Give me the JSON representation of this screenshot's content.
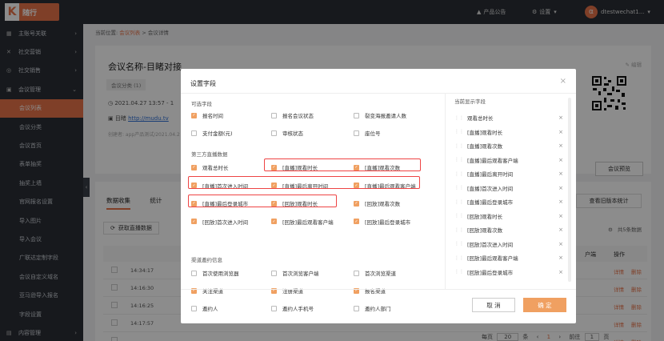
{
  "topbar": {
    "logo_letter": "K",
    "logo_text": "随行",
    "announce": "产品公告",
    "settings": "设置",
    "user": "dtestwechat1..."
  },
  "sidebar": {
    "items": [
      {
        "label": "主账号关联",
        "icon": "grid-icon",
        "arrow": "›"
      },
      {
        "label": "社交营销",
        "icon": "share-icon",
        "arrow": "›"
      },
      {
        "label": "社交销售",
        "icon": "target-icon",
        "arrow": "›"
      },
      {
        "label": "会议管理",
        "icon": "monitor-icon",
        "arrow": "⌄"
      },
      {
        "label": "会议列表",
        "sub": true,
        "active": true
      },
      {
        "label": "会议分类",
        "sub": true
      },
      {
        "label": "会议首页",
        "sub": true
      },
      {
        "label": "表单抽奖",
        "sub": true
      },
      {
        "label": "抽奖上墙",
        "sub": true
      },
      {
        "label": "官网报名设置",
        "sub": true
      },
      {
        "label": "导入图片",
        "sub": true
      },
      {
        "label": "导入会议",
        "sub": true
      },
      {
        "label": "广联达定制字段",
        "sub": true
      },
      {
        "label": "会议自定义域名",
        "sub": true
      },
      {
        "label": "亚马逊导入报名",
        "sub": true
      },
      {
        "label": "字段设置",
        "sub": true
      },
      {
        "label": "内容管理",
        "icon": "doc-icon",
        "arrow": "›"
      }
    ]
  },
  "main": {
    "crumb_prefix": "当前位置:",
    "crumb_link": "会议列表",
    "crumb_sep": ">",
    "crumb_current": "会议详情",
    "conf_title": "会议名称-目睹对接",
    "conf_tag": "会议分类 (1)",
    "edit": "编辑",
    "conf_date": "2021.04.27 13:57 - 1",
    "conf_url_label": "目睹",
    "conf_url": "http://mudu.tv",
    "conf_meta": "创建者:  app产品测试/2021.04.2",
    "preview": "会议预览",
    "tabs": [
      "数据收集",
      "统计"
    ],
    "old_stats": "查看旧版本统计",
    "fetch_live": "获取直播数据",
    "total": "共5条数据",
    "col_client": "户端",
    "col_action": "操作",
    "rows": [
      {
        "time": "14:34:17",
        "a1": "详情",
        "a2": "删除"
      },
      {
        "time": "14:16:30",
        "a1": "详情",
        "a2": "删除"
      },
      {
        "time": "14:16:25",
        "a1": "详情",
        "a2": "删除"
      },
      {
        "time": "14:17:57",
        "a1": "详情",
        "a2": "删除"
      },
      {
        "time": "",
        "a1": "详情",
        "a2": "删除"
      }
    ],
    "pager": {
      "per_page": "每页",
      "size": "20",
      "unit": "条",
      "prev": "‹",
      "page": "1",
      "next": "›",
      "goto": "前往",
      "page2": "1",
      "page_unit": "页"
    }
  },
  "modal": {
    "title": "设置字段",
    "close": "×",
    "sec_optional": "可选字段",
    "sec_third": "第三方直播数据",
    "sec_channel": "渠道邀约信息",
    "right_title": "当前显示字段",
    "optional": [
      {
        "label": "报名时间",
        "checked": true
      },
      {
        "label": "报名会议状态",
        "checked": false
      },
      {
        "label": "裂变海报邀请人数",
        "checked": false
      },
      {
        "label": "支付金额(元)",
        "checked": false
      },
      {
        "label": "审核状态",
        "checked": false
      },
      {
        "label": "座位号",
        "checked": false
      }
    ],
    "third": [
      {
        "label": "观看总时长",
        "checked": true
      },
      {
        "label": "[直播]观看时长",
        "checked": true
      },
      {
        "label": "[直播]观看次数",
        "checked": true
      },
      {
        "label": "[直播]首次进入时间",
        "checked": true
      },
      {
        "label": "[直播]最后离开时间",
        "checked": true
      },
      {
        "label": "[直播]最后观看客户端",
        "checked": true
      },
      {
        "label": "[直播]最后登录城市",
        "checked": true
      },
      {
        "label": "[回放]观看时长",
        "checked": true
      },
      {
        "label": "[回放]观看次数",
        "checked": true
      },
      {
        "label": "[回放]首次进入时间",
        "checked": true
      },
      {
        "label": "[回放]最后观看客户端",
        "checked": true
      },
      {
        "label": "[回放]最后登录城市",
        "checked": true
      }
    ],
    "channel": [
      {
        "label": "首次使用浏览器",
        "checked": false
      },
      {
        "label": "首次浏览客户端",
        "checked": false
      },
      {
        "label": "首次浏览渠道",
        "checked": false
      },
      {
        "label": "关注渠道",
        "checked": true
      },
      {
        "label": "注册渠道",
        "checked": true
      },
      {
        "label": "报名渠道",
        "checked": true
      },
      {
        "label": "邀约人",
        "checked": false
      },
      {
        "label": "邀约人手机号",
        "checked": false
      },
      {
        "label": "邀约人部门",
        "checked": false
      }
    ],
    "selected": [
      "观看总时长",
      "[直播]观看时长",
      "[直播]观看次数",
      "[直播]最后观看客户端",
      "[直播]最后离开时间",
      "[直播]首次进入时间",
      "[直播]最后登录城市",
      "[回放]观看时长",
      "[回放]观看次数",
      "[回放]首次进入时间",
      "[回放]最后观看客户端",
      "[回放]最后登录城市"
    ],
    "remove_glyph": "×",
    "cancel": "取 消",
    "ok": "确 定"
  }
}
